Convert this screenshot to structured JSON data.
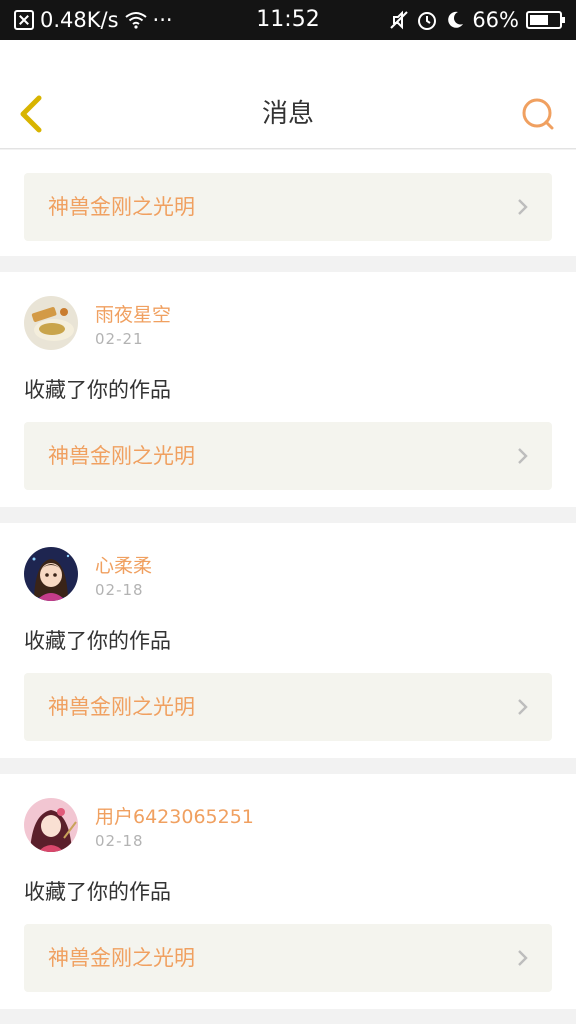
{
  "status_bar": {
    "speed": "0.48K/s",
    "dots": "···",
    "time": "11:52",
    "battery_percent": "66%",
    "battery_level": 0.66
  },
  "header": {
    "title": "消息"
  },
  "partial_card": {
    "work_title": "神兽金刚之光明"
  },
  "messages": [
    {
      "username": "雨夜星空",
      "date": "02-21",
      "action": "收藏了你的作品",
      "work_title": "神兽金刚之光明"
    },
    {
      "username": "心柔柔",
      "date": "02-18",
      "action": "收藏了你的作品",
      "work_title": "神兽金刚之光明"
    },
    {
      "username": "用户642306525​1",
      "date": "02-18",
      "action": "收藏了你的作品",
      "work_title": "神兽金刚之光明"
    }
  ],
  "colors": {
    "accent": "#f0a060",
    "back_arrow": "#d8b400",
    "card_link_bg": "#f4f4ee"
  }
}
